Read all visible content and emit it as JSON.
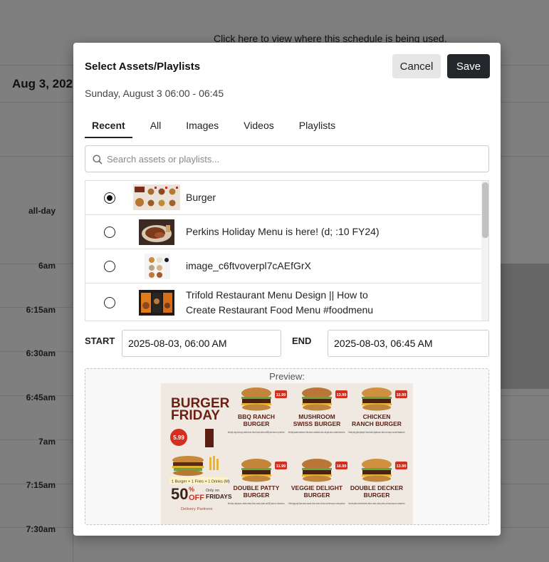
{
  "background": {
    "link_text": "Click here to view where this schedule is being used.",
    "date_heading": "Aug 3, 202",
    "allday_label": "all-day",
    "times": [
      "6am",
      "6:15am",
      "6:30am",
      "6:45am",
      "7am",
      "7:15am",
      "7:30am"
    ]
  },
  "modal": {
    "title": "Select Assets/Playlists",
    "subtitle": "Sunday, August 3 06:00 - 06:45",
    "cancel_label": "Cancel",
    "save_label": "Save",
    "tabs": [
      "Recent",
      "All",
      "Images",
      "Videos",
      "Playlists"
    ],
    "active_tab": "Recent",
    "search_placeholder": "Search assets or playlists...",
    "assets": [
      {
        "name": "Burger",
        "selected": true
      },
      {
        "name": "Perkins Holiday Menu is here! (d; :10 FY24)",
        "selected": false
      },
      {
        "name": "image_c6ftvoverpl7cAEfGrX",
        "selected": false
      },
      {
        "name": "Trifold Restaurant Menu Design || How to",
        "name2": "Create Restaurant Food Menu #foodmenu",
        "selected": false
      }
    ],
    "start_label": "START",
    "start_value": "2025-08-03, 06:00  AM",
    "end_label": "END",
    "end_value": "2025-08-03, 06:45  AM",
    "preview_label": "Preview:"
  },
  "poster": {
    "headline1": "BURGER",
    "headline2": "FRIDAY",
    "combo_price": "5.99",
    "combo_text": "1 Burger + 1 Fries + 1 Drinks (M)",
    "offer": "50",
    "offer_pct": "%",
    "offer_word": "OFF",
    "offer_only": "Only on",
    "offer_day": "FRIDAYS",
    "delivery": "Delivery Partners",
    "items": [
      {
        "name1": "BBQ RANCH",
        "name2": "BURGER",
        "price": "11.99",
        "desc": "Beef patty, crispy onion rings, cheddar cheese, lettuce, tomato, pickles, and BBQ ranch sauce on a pretzel bun."
      },
      {
        "name1": "MUSHROOM",
        "name2": "SWISS BURGER",
        "price": "13.99",
        "desc": "Beef patty, sautéed mushrooms, Swiss cheese, caramelized onions, and garlic aioli on a toasted brioche bun."
      },
      {
        "name1": "CHICKEN",
        "name2": "RANCH BURGER",
        "price": "10.99",
        "desc": "Chicken patty, grilled pineapple, Swiss cheese, teriyaki sauce, lettuce, and mayo on a sweet Hawaiian bun."
      },
      {
        "name1": "DOUBLE PATTY",
        "name2": "BURGER",
        "price": "11.99",
        "desc": "Beef patty, crispy bacon, cheddar cheese, lettuce, tomato, pickles, and BBQ sauce on a brioche bun."
      },
      {
        "name1": "VEGGIE DELIGHT",
        "name2": "BURGER",
        "price": "16.99",
        "desc": "Grilled veggie patty, Swiss cheese, avocado, lettuce, tomato, red onion, and herb mayo on a whole grain bun."
      },
      {
        "name1": "DOUBLE DECKER",
        "name2": "BURGER",
        "price": "13.90",
        "desc": "Two beef patties, American cheese, lettuce, tomato, onions, pickles, and house sauce on a sesame bun."
      }
    ]
  }
}
